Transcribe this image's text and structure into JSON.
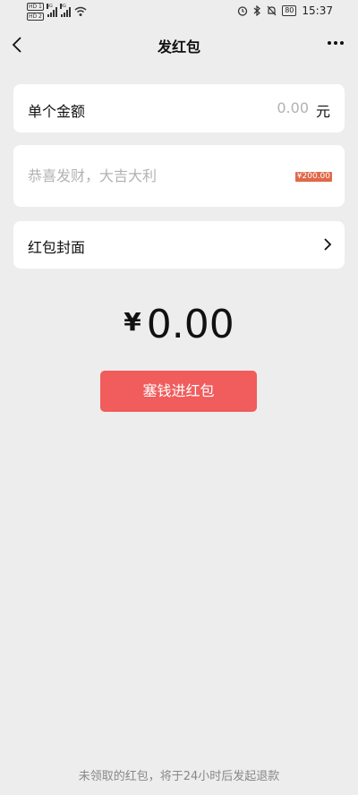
{
  "status_bar": {
    "sim1": "HD 1",
    "sim2": "HD 2",
    "network1": "5G",
    "network2": "4G",
    "battery": "80",
    "time": "15:37",
    "icons": [
      "alarm-icon",
      "bluetooth-icon",
      "mute-icon",
      "battery-icon",
      "wifi-icon"
    ]
  },
  "navbar": {
    "title": "发红包",
    "back_icon": "chevron-left-icon",
    "more_icon": "more-icon"
  },
  "amount": {
    "label": "单个金额",
    "value": "0.00",
    "unit": "元"
  },
  "greeting": {
    "placeholder": "恭喜发财，大吉大利",
    "badge": "¥200.00"
  },
  "cover": {
    "label": "红包封面",
    "arrow_icon": "chevron-right-icon"
  },
  "total": {
    "currency": "¥",
    "value": "0.00"
  },
  "submit_button": "塞钱进红包",
  "footer_note": "未领取的红包，将于24小时后发起退款",
  "colors": {
    "background": "#ededed",
    "card": "#ffffff",
    "primary_button": "#f15c5c",
    "placeholder": "#b2b2b2"
  }
}
